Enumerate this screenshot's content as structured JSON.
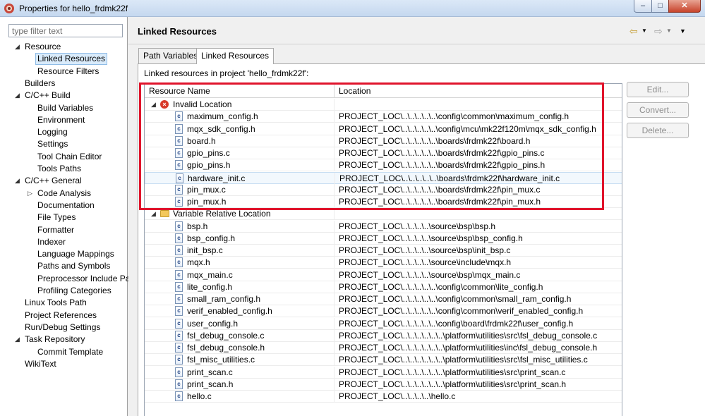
{
  "window": {
    "title": "Properties for hello_frdmk22f"
  },
  "filter": {
    "placeholder": "type filter text"
  },
  "tree": [
    {
      "label": "Resource",
      "level": 0,
      "expanded": true
    },
    {
      "label": "Linked Resources",
      "level": 1,
      "selected": true
    },
    {
      "label": "Resource Filters",
      "level": 1
    },
    {
      "label": "Builders",
      "level": 0
    },
    {
      "label": "C/C++ Build",
      "level": 0,
      "expanded": true
    },
    {
      "label": "Build Variables",
      "level": 1
    },
    {
      "label": "Environment",
      "level": 1
    },
    {
      "label": "Logging",
      "level": 1
    },
    {
      "label": "Settings",
      "level": 1
    },
    {
      "label": "Tool Chain Editor",
      "level": 1
    },
    {
      "label": "Tools Paths",
      "level": 1
    },
    {
      "label": "C/C++ General",
      "level": 0,
      "expanded": true
    },
    {
      "label": "Code Analysis",
      "level": 1,
      "collapsed": true
    },
    {
      "label": "Documentation",
      "level": 1
    },
    {
      "label": "File Types",
      "level": 1
    },
    {
      "label": "Formatter",
      "level": 1
    },
    {
      "label": "Indexer",
      "level": 1
    },
    {
      "label": "Language Mappings",
      "level": 1
    },
    {
      "label": "Paths and Symbols",
      "level": 1
    },
    {
      "label": "Preprocessor Include Pa",
      "level": 1
    },
    {
      "label": "Profiling Categories",
      "level": 1
    },
    {
      "label": "Linux Tools Path",
      "level": 0
    },
    {
      "label": "Project References",
      "level": 0
    },
    {
      "label": "Run/Debug Settings",
      "level": 0
    },
    {
      "label": "Task Repository",
      "level": 0,
      "expanded": true
    },
    {
      "label": "Commit Template",
      "level": 1
    },
    {
      "label": "WikiText",
      "level": 0
    }
  ],
  "page": {
    "title": "Linked Resources"
  },
  "tabs": [
    {
      "label": "Path Variables",
      "active": false
    },
    {
      "label": "Linked Resources",
      "active": true
    }
  ],
  "description": "Linked resources in project 'hello_frdmk22f':",
  "table": {
    "columns": [
      "Resource Name",
      "Location"
    ],
    "groups": [
      {
        "name": "Invalid Location",
        "icon": "error-icon",
        "rows": [
          {
            "name": "maximum_config.h",
            "location": "PROJECT_LOC\\..\\..\\..\\..\\..\\config\\common\\maximum_config.h"
          },
          {
            "name": "mqx_sdk_config.h",
            "location": "PROJECT_LOC\\..\\..\\..\\..\\..\\config\\mcu\\mk22f120m\\mqx_sdk_config.h"
          },
          {
            "name": "board.h",
            "location": "PROJECT_LOC\\..\\..\\..\\..\\..\\boards\\frdmk22f\\board.h"
          },
          {
            "name": "gpio_pins.c",
            "location": "PROJECT_LOC\\..\\..\\..\\..\\..\\boards\\frdmk22f\\gpio_pins.c"
          },
          {
            "name": "gpio_pins.h",
            "location": "PROJECT_LOC\\..\\..\\..\\..\\..\\boards\\frdmk22f\\gpio_pins.h"
          },
          {
            "name": "hardware_init.c",
            "location": "PROJECT_LOC\\..\\..\\..\\..\\..\\boards\\frdmk22f\\hardware_init.c",
            "hover": true
          },
          {
            "name": "pin_mux.c",
            "location": "PROJECT_LOC\\..\\..\\..\\..\\..\\boards\\frdmk22f\\pin_mux.c"
          },
          {
            "name": "pin_mux.h",
            "location": "PROJECT_LOC\\..\\..\\..\\..\\..\\boards\\frdmk22f\\pin_mux.h"
          }
        ]
      },
      {
        "name": "Variable Relative Location",
        "icon": "folder-icon",
        "rows": [
          {
            "name": "bsp.h",
            "location": "PROJECT_LOC\\..\\..\\..\\..\\source\\bsp\\bsp.h"
          },
          {
            "name": "bsp_config.h",
            "location": "PROJECT_LOC\\..\\..\\..\\..\\source\\bsp\\bsp_config.h"
          },
          {
            "name": "init_bsp.c",
            "location": "PROJECT_LOC\\..\\..\\..\\..\\source\\bsp\\init_bsp.c"
          },
          {
            "name": "mqx.h",
            "location": "PROJECT_LOC\\..\\..\\..\\..\\source\\include\\mqx.h"
          },
          {
            "name": "mqx_main.c",
            "location": "PROJECT_LOC\\..\\..\\..\\..\\source\\bsp\\mqx_main.c"
          },
          {
            "name": "lite_config.h",
            "location": "PROJECT_LOC\\..\\..\\..\\..\\..\\config\\common\\lite_config.h"
          },
          {
            "name": "small_ram_config.h",
            "location": "PROJECT_LOC\\..\\..\\..\\..\\..\\config\\common\\small_ram_config.h"
          },
          {
            "name": "verif_enabled_config.h",
            "location": "PROJECT_LOC\\..\\..\\..\\..\\..\\config\\common\\verif_enabled_config.h"
          },
          {
            "name": "user_config.h",
            "location": "PROJECT_LOC\\..\\..\\..\\..\\..\\config\\board\\frdmk22f\\user_config.h"
          },
          {
            "name": "fsl_debug_console.c",
            "location": "PROJECT_LOC\\..\\..\\..\\..\\..\\..\\platform\\utilities\\src\\fsl_debug_console.c"
          },
          {
            "name": "fsl_debug_console.h",
            "location": "PROJECT_LOC\\..\\..\\..\\..\\..\\..\\platform\\utilities\\inc\\fsl_debug_console.h"
          },
          {
            "name": "fsl_misc_utilities.c",
            "location": "PROJECT_LOC\\..\\..\\..\\..\\..\\..\\platform\\utilities\\src\\fsl_misc_utilities.c"
          },
          {
            "name": "print_scan.c",
            "location": "PROJECT_LOC\\..\\..\\..\\..\\..\\..\\platform\\utilities\\src\\print_scan.c"
          },
          {
            "name": "print_scan.h",
            "location": "PROJECT_LOC\\..\\..\\..\\..\\..\\..\\platform\\utilities\\src\\print_scan.h"
          },
          {
            "name": "hello.c",
            "location": "PROJECT_LOC\\..\\..\\..\\..\\hello.c"
          }
        ]
      }
    ]
  },
  "buttons": [
    {
      "label": "Edit...",
      "enabled": false
    },
    {
      "label": "Convert...",
      "enabled": false
    },
    {
      "label": "Delete...",
      "enabled": false
    }
  ],
  "colors": {
    "highlight": "#e0142c",
    "selection": "#d9ebfb"
  }
}
